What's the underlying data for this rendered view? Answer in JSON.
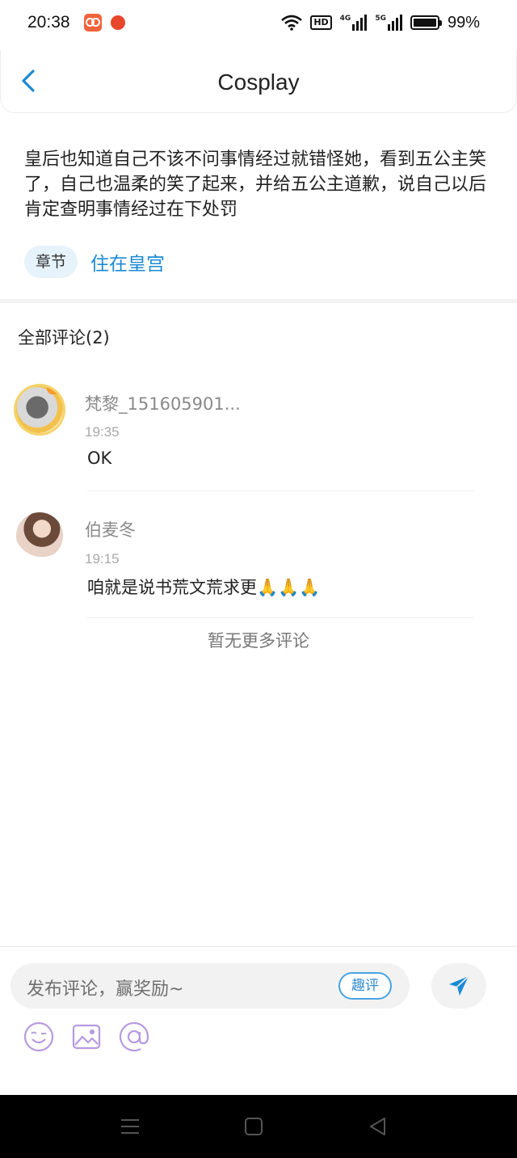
{
  "status_bar": {
    "time": "20:38",
    "network_badge": "HD",
    "signal_1": "4G",
    "signal_2": "5G",
    "battery": "99%",
    "battery_level": 0.99,
    "icons": [
      "app-notification-icon",
      "app-notification-icon",
      "wifi-icon",
      "hd-icon",
      "signal-icon",
      "signal-icon",
      "battery-icon"
    ]
  },
  "header": {
    "title": "Cosplay",
    "back_icon": "chevron-left-icon",
    "accent": "#1a8ad4"
  },
  "post": {
    "text": "皇后也知道自己不该不问事情经过就错怪她，看到五公主笑了，自己也温柔的笑了起来，并给五公主道歉，说自己以后肯定查明事情经过在下处罚",
    "chapter_tag": "章节",
    "chapter_link": "住在皇宫"
  },
  "comments": {
    "title": "全部评论(2)",
    "items": [
      {
        "name": "梵黎_151605901...",
        "time": "19:35",
        "text": "OK",
        "avatar": "author-avatar"
      },
      {
        "name": "伯麦冬",
        "time": "19:15",
        "text": "咱就是说书荒文荒求更🙏🙏🙏",
        "avatar": "user-avatar"
      }
    ],
    "end_text": "暂无更多评论"
  },
  "composer": {
    "placeholder": "发布评论，赢奖励~",
    "quping_label": "趣评",
    "send_icon": "send-icon",
    "tools": [
      "emoji-icon",
      "image-icon",
      "mention-icon"
    ],
    "tool_color": "#b79ae0"
  },
  "system_nav": {
    "buttons": [
      "menu-icon",
      "home-icon",
      "back-icon"
    ]
  }
}
